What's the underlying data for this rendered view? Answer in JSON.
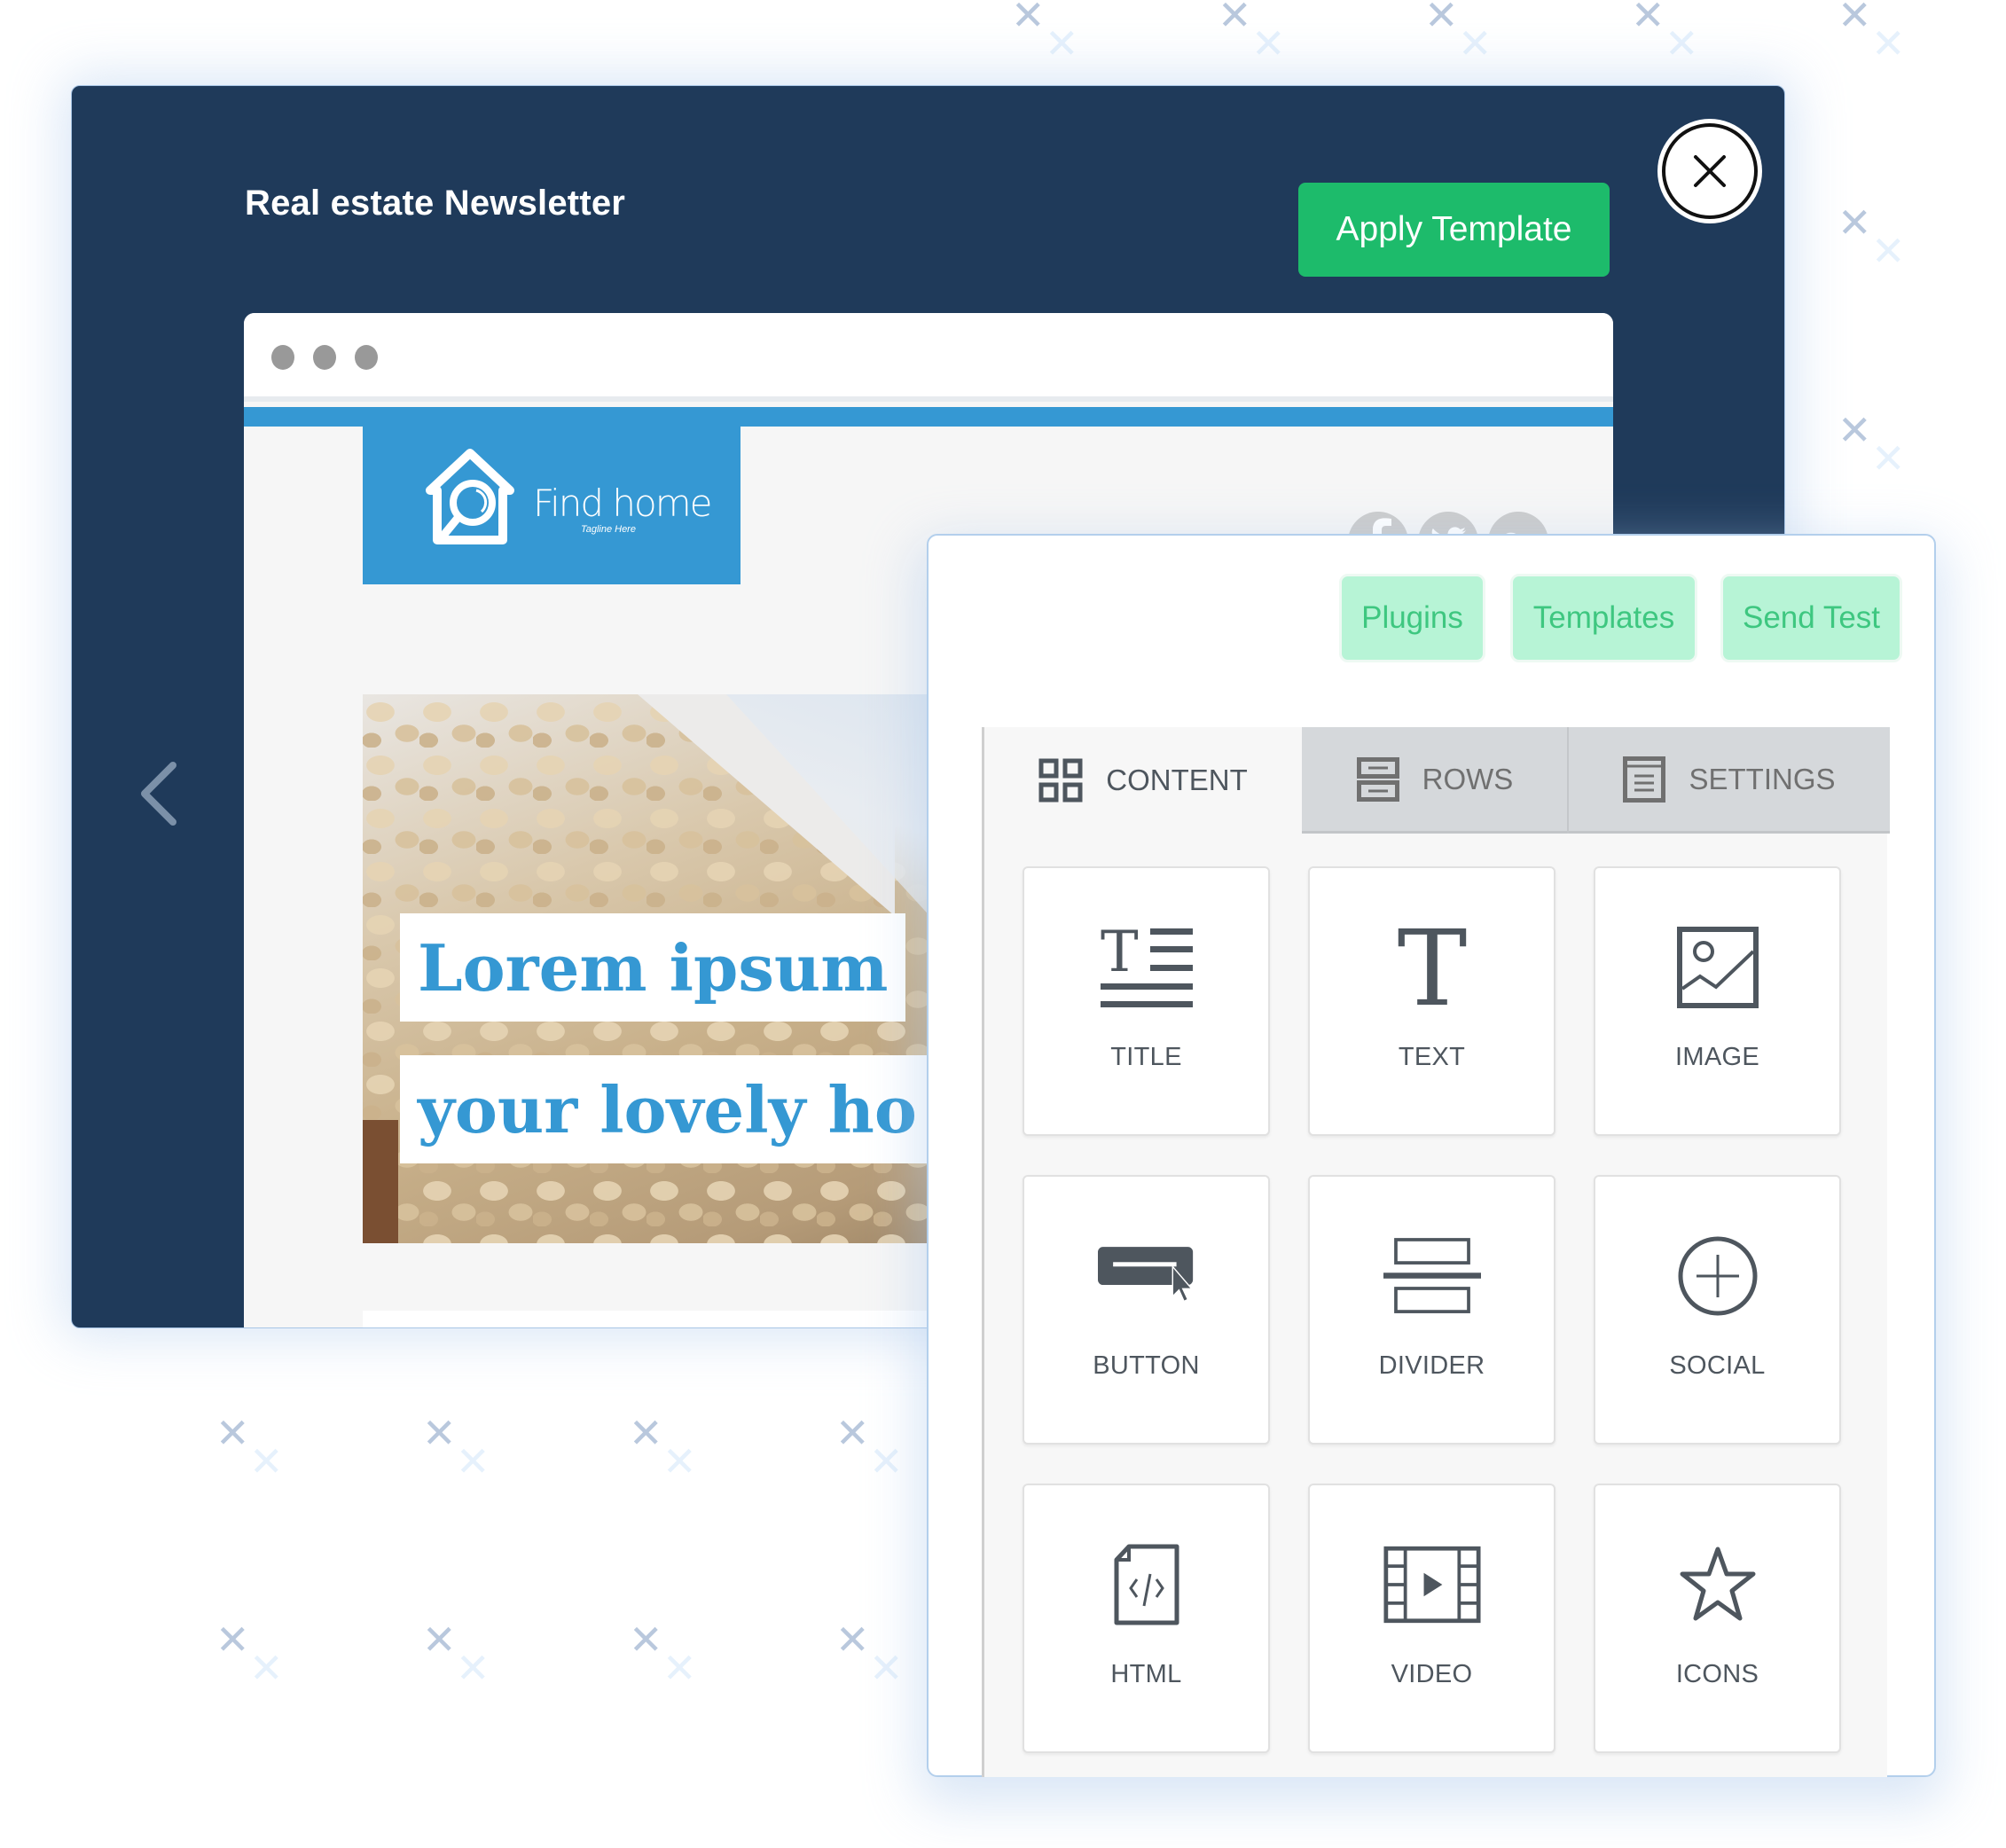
{
  "modal": {
    "title": "Real estate Newsletter",
    "apply_button": "Apply Template",
    "close_icon": "close-circle-icon",
    "prev_icon": "chevron-left-icon"
  },
  "email_preview": {
    "window_dots": 3,
    "logo": {
      "name": "Find home",
      "tagline": "Tagline Here",
      "icon": "house-search-icon"
    },
    "social_icons": [
      {
        "name": "facebook-icon",
        "glyph": "f"
      },
      {
        "name": "twitter-icon",
        "glyph": "🐦"
      },
      {
        "name": "google-plus-icon",
        "glyph": "G+"
      }
    ],
    "headline_line1": "Lorem ipsum",
    "headline_line2": "your lovely ho"
  },
  "builder": {
    "top_buttons": [
      {
        "label": "Plugins"
      },
      {
        "label": "Templates"
      },
      {
        "label": "Send Test"
      }
    ],
    "tabs": [
      {
        "label": "CONTENT",
        "icon": "grid-icon",
        "active": true
      },
      {
        "label": "ROWS",
        "icon": "rows-icon",
        "active": false
      },
      {
        "label": "SETTINGS",
        "icon": "settings-doc-icon",
        "active": false
      }
    ],
    "blocks": [
      {
        "label": "TITLE",
        "icon": "title-icon"
      },
      {
        "label": "TEXT",
        "icon": "text-icon"
      },
      {
        "label": "IMAGE",
        "icon": "image-icon"
      },
      {
        "label": "BUTTON",
        "icon": "button-icon"
      },
      {
        "label": "DIVIDER",
        "icon": "divider-icon"
      },
      {
        "label": "SOCIAL",
        "icon": "social-icon"
      },
      {
        "label": "HTML",
        "icon": "html-icon"
      },
      {
        "label": "VIDEO",
        "icon": "video-icon"
      },
      {
        "label": "ICONS",
        "icon": "star-icon"
      }
    ]
  },
  "colors": {
    "modal_bg": "#1f3a5a",
    "apply_green": "#1dbb6b",
    "brand_blue": "#3598d3",
    "pill_bg": "#b7f4d6",
    "pill_text": "#3ec780",
    "icon_gray": "#4e565e"
  }
}
